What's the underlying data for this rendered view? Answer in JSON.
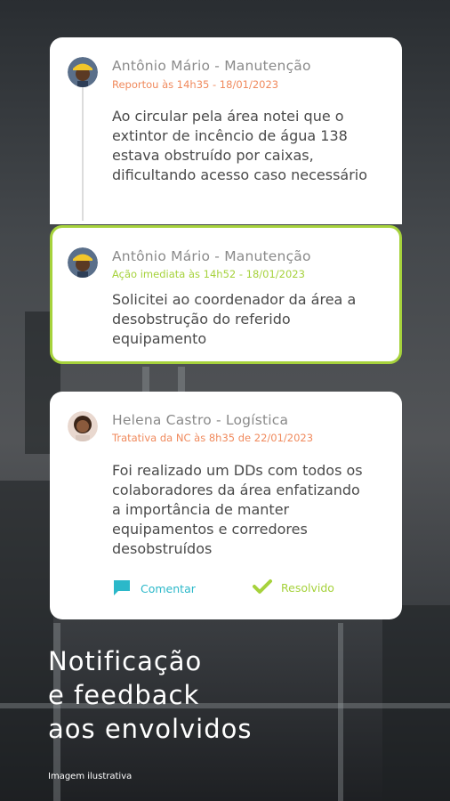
{
  "colors": {
    "accent_green": "#a6d23c",
    "accent_orange": "#f08a5d",
    "accent_cyan": "#2bb8c9"
  },
  "feed": [
    {
      "author": "Antônio Mário - Manutenção",
      "meta": "Reportou às 14h35 - 18/01/2023",
      "text": "Ao circular pela área notei que o extintor de incêncio de água 138 estava obstruído por caixas, dificultando acesso caso necessário",
      "avatar_icon": "worker-avatar"
    },
    {
      "author": "Antônio Mário - Manutenção",
      "meta": "Ação imediata às 14h52 - 18/01/2023",
      "text": "Solicitei ao coordenador da área a desobstrução do referido equipamento",
      "avatar_icon": "worker-avatar"
    },
    {
      "author": "Helena Castro - Logística",
      "meta": "Tratativa da NC às 8h35 de 22/01/2023",
      "text": "Foi realizado um DDs com todos os colaboradores da área enfatizando a importância de manter equipamentos e corredores desobstruídos",
      "avatar_icon": "woman-avatar",
      "actions": {
        "comment_label": "Comentar",
        "comment_icon": "chat-icon",
        "resolved_label": "Resolvido",
        "resolved_icon": "check-icon"
      }
    }
  ],
  "headline": {
    "line1": "Notificação",
    "line2": "e feedback",
    "line3": "aos envolvidos"
  },
  "caption": "Imagem ilustrativa"
}
